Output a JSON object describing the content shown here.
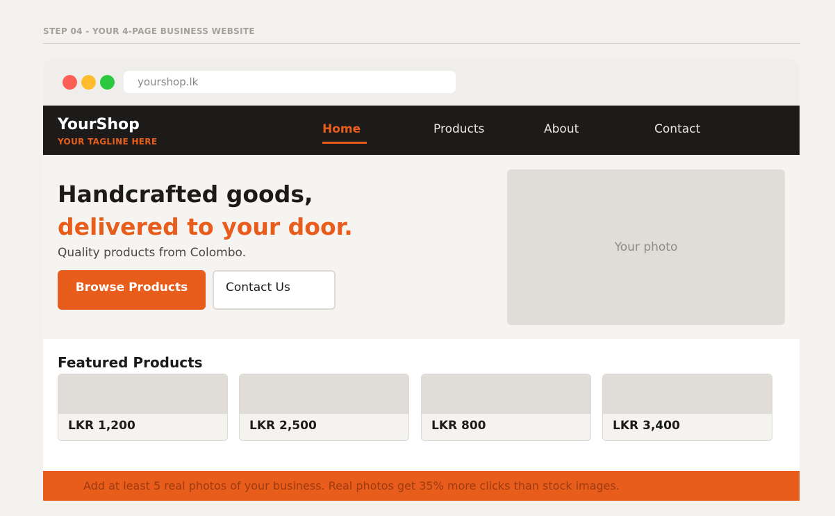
{
  "step": {
    "label": "STEP 04 - YOUR 4-PAGE BUSINESS WEBSITE"
  },
  "browser": {
    "url": "yourshop.lk",
    "window_controls": [
      "close-dot",
      "minimize-dot",
      "maximize-dot"
    ]
  },
  "site": {
    "brand": {
      "name": "YourShop",
      "tagline": "YOUR TAGLINE HERE"
    },
    "nav": [
      {
        "label": "Home",
        "active": true
      },
      {
        "label": "Products",
        "active": false
      },
      {
        "label": "About",
        "active": false
      },
      {
        "label": "Contact",
        "active": false
      }
    ],
    "hero": {
      "headline": "Handcrafted goods,",
      "headline_accent": "delivered to your door.",
      "subtitle": "Quality products from Colombo.",
      "primary_button": "Browse Products",
      "secondary_button": "Contact Us",
      "photo_placeholder": "Your photo"
    },
    "featured": {
      "title": "Featured Products",
      "products": [
        {
          "price": "LKR 1,200"
        },
        {
          "price": "LKR 2,500"
        },
        {
          "price": "LKR 800"
        },
        {
          "price": "LKR 3,400"
        }
      ]
    },
    "tip": "Add at least 5 real photos of your business. Real photos get 35% more clicks than stock images."
  },
  "colors": {
    "accent": "#e85d1c",
    "navbar": "#1c1b1a",
    "placeholder": "#e0ddd8",
    "page_bg": "#f3f2ef"
  }
}
